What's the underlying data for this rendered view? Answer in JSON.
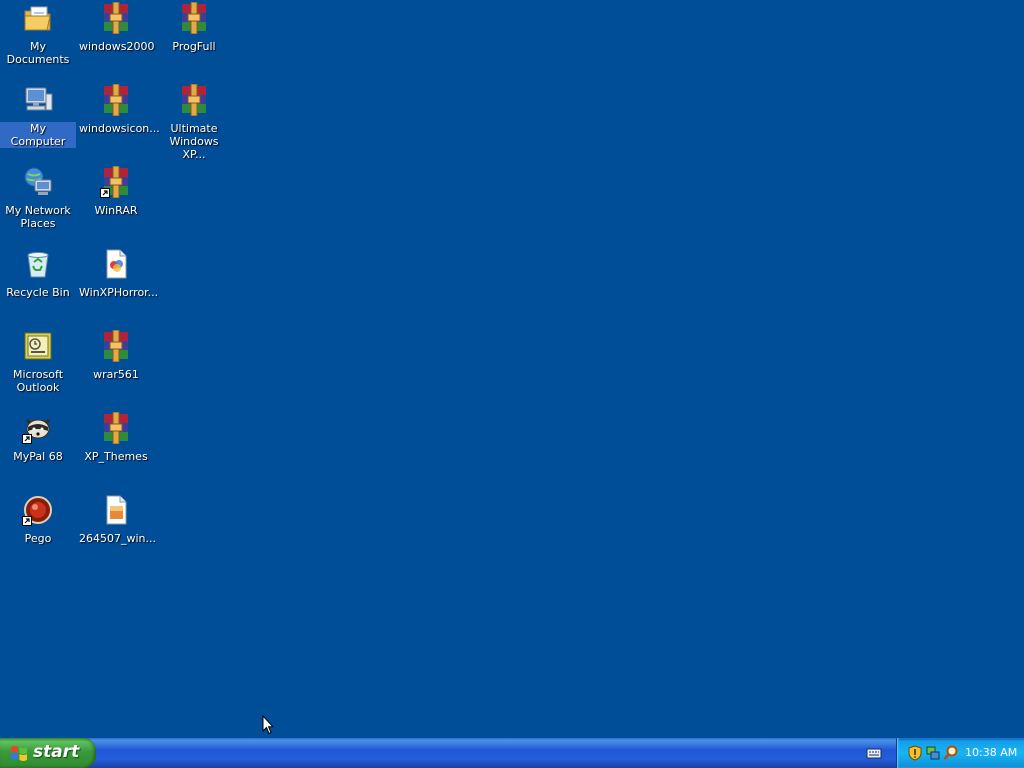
{
  "desktop": {
    "icons": [
      {
        "label": "My Documents",
        "icon": "folder-documents-icon"
      },
      {
        "label": "windows2000",
        "icon": "winrar-archive-icon"
      },
      {
        "label": "ProgFull",
        "icon": "winrar-archive-icon"
      },
      {
        "label": "My Computer",
        "icon": "computer-icon",
        "selected": true
      },
      {
        "label": "windowsicon...",
        "icon": "winrar-archive-icon"
      },
      {
        "label": "Ultimate Windows XP...",
        "icon": "winrar-archive-icon"
      },
      {
        "label": "My Network Places",
        "icon": "network-places-icon"
      },
      {
        "label": "WinRAR",
        "icon": "winrar-shortcut-icon"
      },
      {
        "label": "Recycle Bin",
        "icon": "recycle-bin-icon"
      },
      {
        "label": "WinXPHorror...",
        "icon": "image-file-icon"
      },
      {
        "label": "Microsoft Outlook",
        "icon": "outlook-icon"
      },
      {
        "label": "wrar561",
        "icon": "winrar-archive-icon"
      },
      {
        "label": "MyPal 68",
        "icon": "mypal-browser-icon"
      },
      {
        "label": "XP_Themes",
        "icon": "winrar-archive-icon"
      },
      {
        "label": "Pego",
        "icon": "pego-icon"
      },
      {
        "label": "264507_win...",
        "icon": "image-file-icon"
      }
    ]
  },
  "taskbar": {
    "start_label": "start",
    "clock": "10:38 AM",
    "tray_icons": [
      "security-shield-icon",
      "network-status-icon",
      "search-icon"
    ]
  },
  "colors": {
    "desktop_background": "#004e98",
    "selection": "#316ac5",
    "start_button": "#3c9a3c",
    "taskbar": "#245edb",
    "tray": "#18b5f2"
  }
}
